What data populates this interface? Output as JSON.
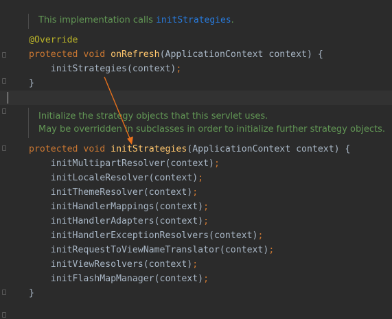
{
  "doc1": {
    "text": "This implementation calls ",
    "ref": "initStrategies",
    "end": "."
  },
  "onRefresh": {
    "annotation": "@Override",
    "kw_protected": "protected",
    "kw_void": "void",
    "name": "onRefresh",
    "params": "(ApplicationContext context) {",
    "body_call": "initStrategies(context)",
    "body_semicolon": ";",
    "close": "}"
  },
  "doc2": {
    "line1": "Initialize the strategy objects that this servlet uses.",
    "line2": "May be overridden in subclasses in order to initialize further strategy objects."
  },
  "initStrategies": {
    "kw_protected": "protected",
    "kw_void": "void",
    "name": "initStrategies",
    "params": "(ApplicationContext context) {",
    "calls": [
      "initMultipartResolver(context)",
      "initLocaleResolver(context)",
      "initThemeResolver(context)",
      "initHandlerMappings(context)",
      "initHandlerAdapters(context)",
      "initHandlerExceptionResolvers(context)",
      "initRequestToViewNameTranslator(context)",
      "initViewResolvers(context)",
      "initFlashMapManager(context)"
    ],
    "semicolon": ";",
    "close": "}"
  },
  "colors": {
    "background": "#2b2b2b",
    "keyword": "#cc7832",
    "method_declaration": "#ffc66d",
    "annotation": "#bbb529",
    "doc_comment": "#629755",
    "doc_link": "#287bde",
    "plain": "#a9b7c6",
    "arrow": "#e8711c"
  }
}
